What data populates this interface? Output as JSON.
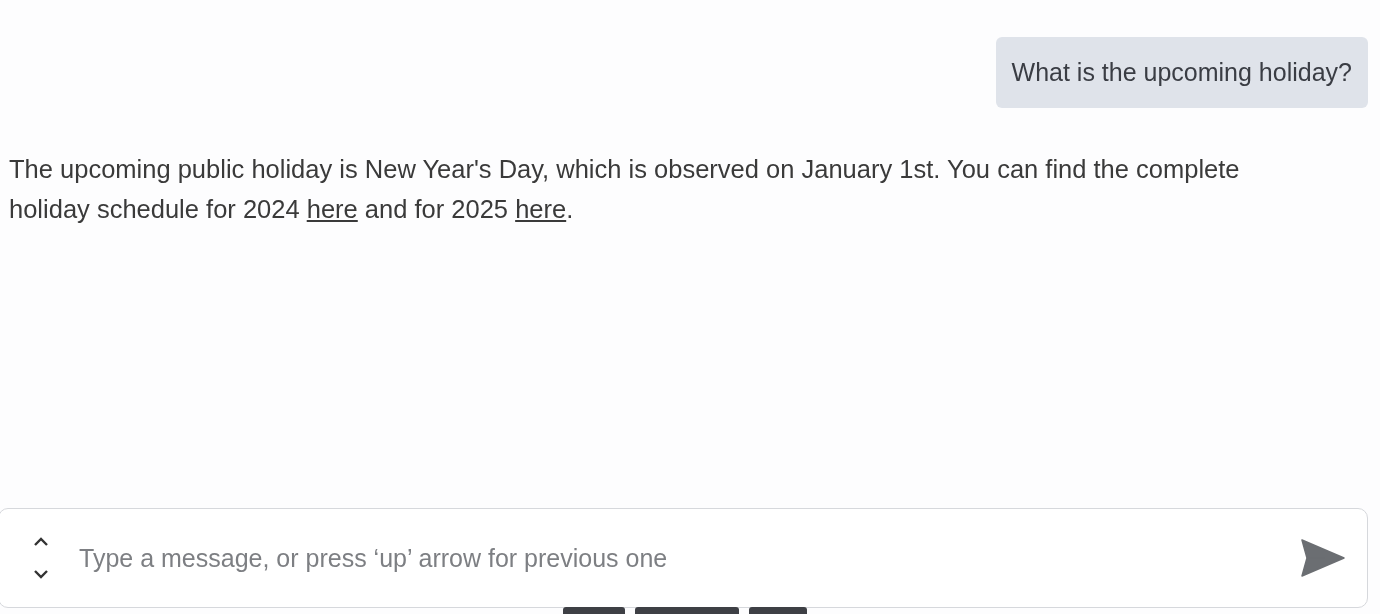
{
  "user_message": {
    "text": "What is the upcoming holiday?"
  },
  "assistant_message": {
    "parts": [
      {
        "kind": "text",
        "text": "The upcoming public holiday is New Year's Day, which is observed on January 1st. You can find the complete holiday schedule for 2024 "
      },
      {
        "kind": "link",
        "text": "here"
      },
      {
        "kind": "text",
        "text": " and for 2025 "
      },
      {
        "kind": "link",
        "text": "here"
      },
      {
        "kind": "text",
        "text": "."
      }
    ]
  },
  "composer": {
    "placeholder": "Type a message, or press ‘up’ arrow for previous one"
  }
}
